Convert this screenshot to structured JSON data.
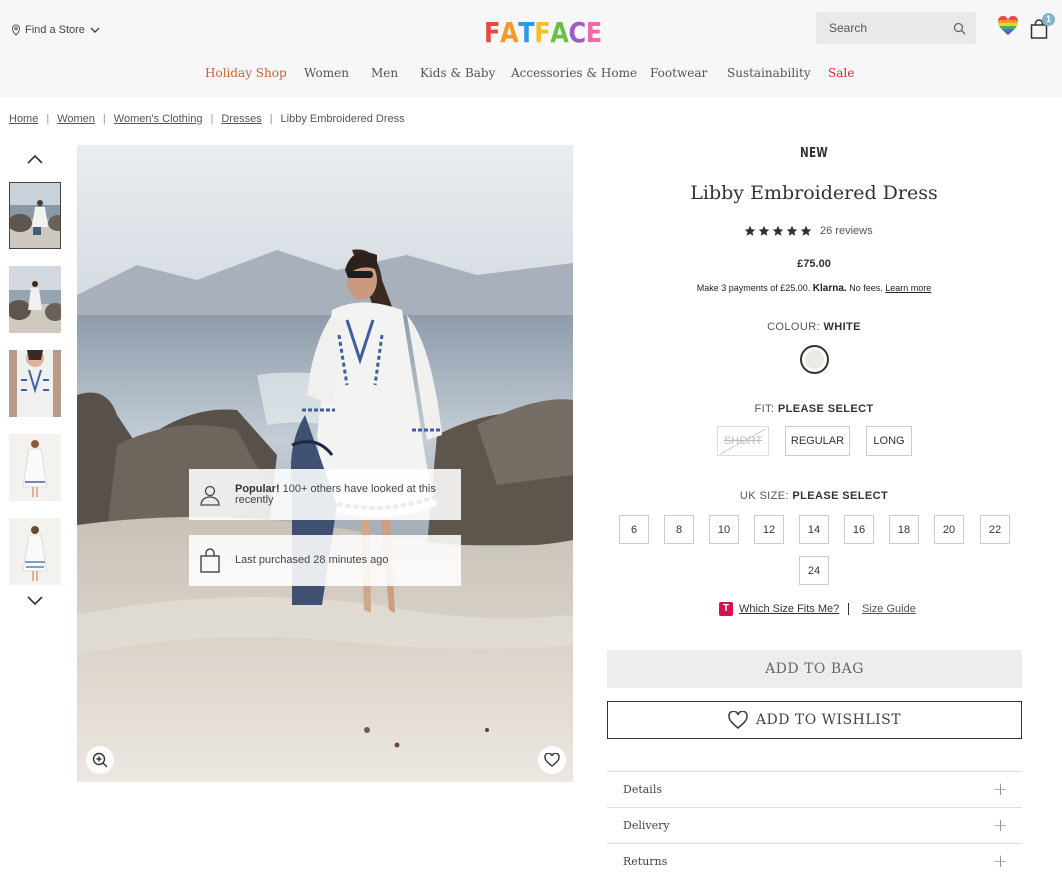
{
  "header": {
    "find_store": "Find a Store",
    "logo_letters": [
      {
        "ch": "F",
        "color": "#e8483d"
      },
      {
        "ch": "A",
        "color": "#f29a2e"
      },
      {
        "ch": "T",
        "color": "#2d9be0"
      },
      {
        "ch": "F",
        "color": "#f2c12e"
      },
      {
        "ch": "A",
        "color": "#6cbf4a"
      },
      {
        "ch": "C",
        "color": "#9d5cc7"
      },
      {
        "ch": "E",
        "color": "#f06aa5"
      }
    ],
    "search_placeholder": "Search",
    "bag_count": "1"
  },
  "nav": [
    {
      "label": "Holiday Shop",
      "color": "#c0623a"
    },
    {
      "label": "Women",
      "color": "#555555"
    },
    {
      "label": "Men",
      "color": "#555555"
    },
    {
      "label": "Kids & Baby",
      "color": "#555555"
    },
    {
      "label": "Accessories & Home",
      "color": "#555555"
    },
    {
      "label": "Footwear",
      "color": "#555555"
    },
    {
      "label": "Sustainability",
      "color": "#555555"
    },
    {
      "label": "Sale",
      "color": "#d9243b"
    }
  ],
  "breadcrumb": {
    "links": [
      "Home",
      "Women",
      "Women's Clothing",
      "Dresses"
    ],
    "current": "Libby Embroidered Dress"
  },
  "gallery": {
    "notices": [
      {
        "bold": "Popular!",
        "text": " 100+ others have looked at this recently"
      },
      {
        "bold": "",
        "text": "Last purchased 28 minutes ago"
      }
    ]
  },
  "product": {
    "tag": "NEW",
    "title": "Libby Embroidered Dress",
    "rating": 5,
    "reviews": "26 reviews",
    "price": "£75.00",
    "klarna_pre": "Make 3 payments of £25.00.",
    "klarna_brand": "Klarna.",
    "klarna_post": "No fees.",
    "klarna_link": "Learn more",
    "colour_label": "COLOUR:",
    "colour_value": "WHITE",
    "fit_label": "FIT:",
    "fit_value": "PLEASE SELECT",
    "fits": [
      "SHORT",
      "REGULAR",
      "LONG"
    ],
    "size_label": "UK SIZE:",
    "size_value": "PLEASE SELECT",
    "sizes": [
      "6",
      "8",
      "10",
      "12",
      "14",
      "16",
      "18",
      "20",
      "22",
      "24"
    ],
    "size_help": "Which Size Fits Me?",
    "size_guide": "Size Guide",
    "add_to_bag": "ADD TO BAG",
    "add_to_wishlist": "ADD TO WISHLIST",
    "accordion": [
      "Details",
      "Delivery",
      "Returns"
    ]
  }
}
